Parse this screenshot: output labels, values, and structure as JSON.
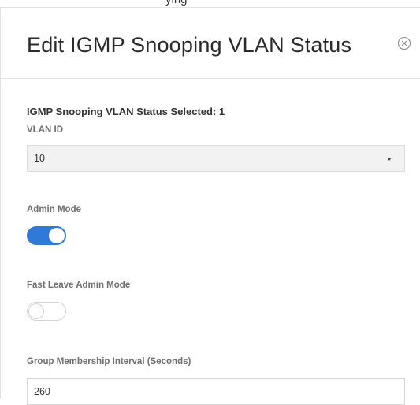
{
  "background_partial_text": "ying",
  "modal": {
    "title": "Edit IGMP Snooping VLAN Status",
    "close_icon": "close-circle-icon"
  },
  "form": {
    "selected_label": "IGMP Snooping VLAN Status Selected:",
    "selected_count": "1",
    "vlan_id": {
      "label": "VLAN ID",
      "value": "10",
      "icon": "caret-down-icon"
    },
    "admin_mode": {
      "label": "Admin Mode",
      "enabled": true
    },
    "fast_leave_admin_mode": {
      "label": "Fast Leave Admin Mode",
      "enabled": false
    },
    "group_membership_interval": {
      "label": "Group Membership Interval (Seconds)",
      "value": "260"
    }
  },
  "colors": {
    "toggle_on": "#2f7ad6",
    "select_bg": "#f2f2f2"
  }
}
